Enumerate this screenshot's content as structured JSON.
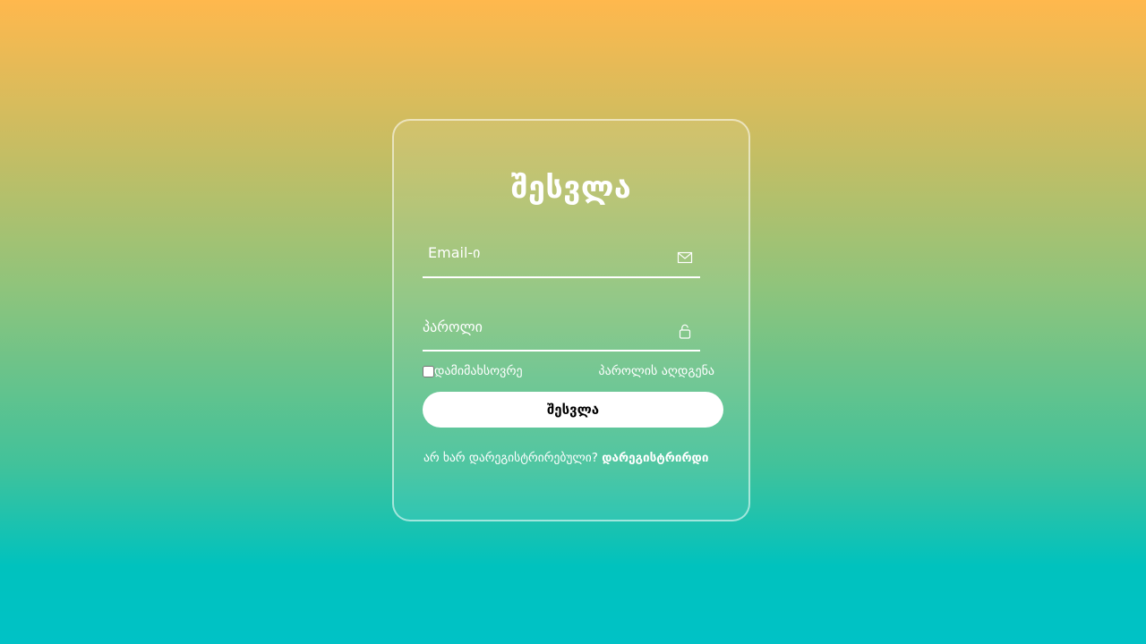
{
  "login": {
    "title": "შესვლა",
    "email_placeholder": "Email-ი",
    "email_value": "",
    "email_icon": "envelope-icon",
    "password_placeholder": "პაროლი",
    "password_value": "",
    "password_icon": "lock-icon",
    "remember_label": "დამიმახსოვრე",
    "remember_checked": false,
    "forgot_label": "პაროლის აღდგენა",
    "submit_label": "შესვლა",
    "register_prompt": "არ ხარ დარეგისტრირებული?",
    "register_link": "დარეგისტრირდი"
  },
  "colors": {
    "gradient_top": "#ffb84d",
    "gradient_bottom": "#00c2c6",
    "button_bg": "#ffffff",
    "button_text": "#000000",
    "text": "#ffffff"
  }
}
